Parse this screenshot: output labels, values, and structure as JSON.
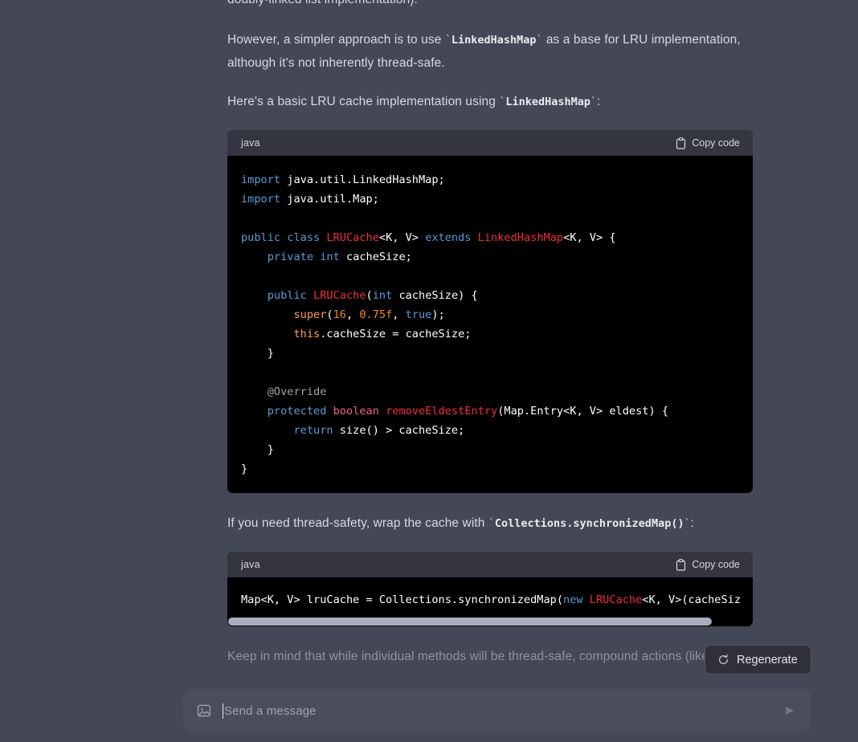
{
  "conversation": {
    "paragraphs": [
      {
        "id": "p-top",
        "text": "doubly-linked list implementation)."
      },
      {
        "id": "p-however",
        "pre": "However, a simpler approach is to use ",
        "code": "LinkedHashMap",
        "post": " as a base for LRU implementation, although it's not inherently thread-safe."
      },
      {
        "id": "p-heres",
        "pre": "Here's a basic LRU cache implementation using ",
        "code": "LinkedHashMap",
        "post": ":"
      },
      {
        "id": "p-threadsafety",
        "pre": "If you need thread-safety, wrap the cache with ",
        "code": "Collections.synchronizedMap()",
        "post": ":"
      },
      {
        "id": "p-keepinmind",
        "text": "Keep in mind that while individual methods will be thread-safe, compound actions (like"
      }
    ]
  },
  "code_blocks": [
    {
      "language": "java",
      "copy_label": "Copy code",
      "copy_icon": "clipboard-icon",
      "lines": [
        "import java.util.LinkedHashMap;",
        "import java.util.Map;",
        "",
        "public class LRUCache<K, V> extends LinkedHashMap<K, V> {",
        "    private int cacheSize;",
        "",
        "    public LRUCache(int cacheSize) {",
        "        super(16, 0.75f, true);",
        "        this.cacheSize = cacheSize;",
        "    }",
        "",
        "    @Override",
        "    protected boolean removeEldestEntry(Map.Entry<K, V> eldest) {",
        "        return size() > cacheSize;",
        "    }",
        "}"
      ]
    },
    {
      "language": "java",
      "copy_label": "Copy code",
      "copy_icon": "clipboard-icon",
      "lines": [
        "Map<K, V> lruCache = Collections.synchronizedMap(new LRUCache<K, V>(cacheSiz"
      ],
      "has_horizontal_scrollbar": true
    }
  ],
  "regenerate": {
    "label": "Regenerate",
    "icon": "refresh-icon"
  },
  "composer": {
    "placeholder": "Send a message",
    "attach_icon": "image-icon",
    "send_icon": "send-icon",
    "value": ""
  },
  "colors": {
    "page_background": "#434756",
    "code_header": "#343541",
    "code_body": "#000000",
    "composer_background": "#4a4d5c",
    "keyword": "#569cd6",
    "class_name": "#f22c3d",
    "type_name": "#f06292",
    "number": "#f5871f",
    "annotation": "#9aa0ad",
    "scrollbar_thumb": "#a9adbb",
    "prose_text": "#d6d9e3",
    "faded_text": "#8e93a3"
  }
}
